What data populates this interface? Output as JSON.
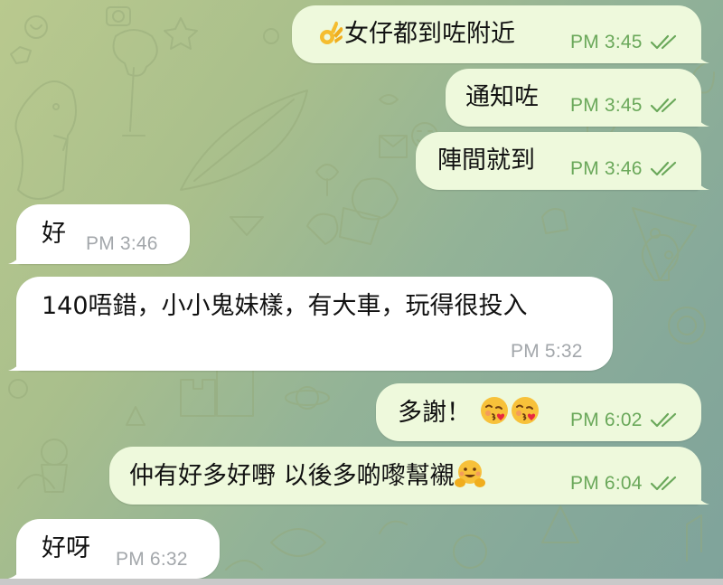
{
  "theme": {
    "out_bubble_color": "#eef9dc",
    "in_bubble_color": "#ffffff",
    "out_time_color": "#6aa85a",
    "in_time_color": "#a3a7ab",
    "tick_color": "#6aa85a"
  },
  "messages": [
    {
      "direction": "outgoing",
      "emoji_before": "ok-hand-emoji",
      "text": "女仔都到咗附近",
      "time": "PM 3:45",
      "status": "read-double-check-icon"
    },
    {
      "direction": "outgoing",
      "text": "通知咗",
      "time": "PM 3:45",
      "status": "read-double-check-icon"
    },
    {
      "direction": "outgoing",
      "text": "陣間就到",
      "time": "PM 3:46",
      "status": "read-double-check-icon"
    },
    {
      "direction": "incoming",
      "text": "好",
      "time": "PM 3:46"
    },
    {
      "direction": "incoming",
      "text": "140唔錯，小小鬼妹樣，有大車，玩得很投入",
      "time": "PM 5:32"
    },
    {
      "direction": "outgoing",
      "text": "多謝！",
      "emoji_after": [
        "kissing-heart-emoji",
        "kissing-heart-emoji"
      ],
      "time": "PM 6:02",
      "status": "read-double-check-icon"
    },
    {
      "direction": "outgoing",
      "text": "仲有好多好嘢 以後多啲嚟幫襯",
      "emoji_after": [
        "hugging-face-emoji"
      ],
      "time": "PM 6:04",
      "status": "read-double-check-icon"
    },
    {
      "direction": "incoming",
      "text": "好呀",
      "time": "PM 6:32"
    }
  ]
}
